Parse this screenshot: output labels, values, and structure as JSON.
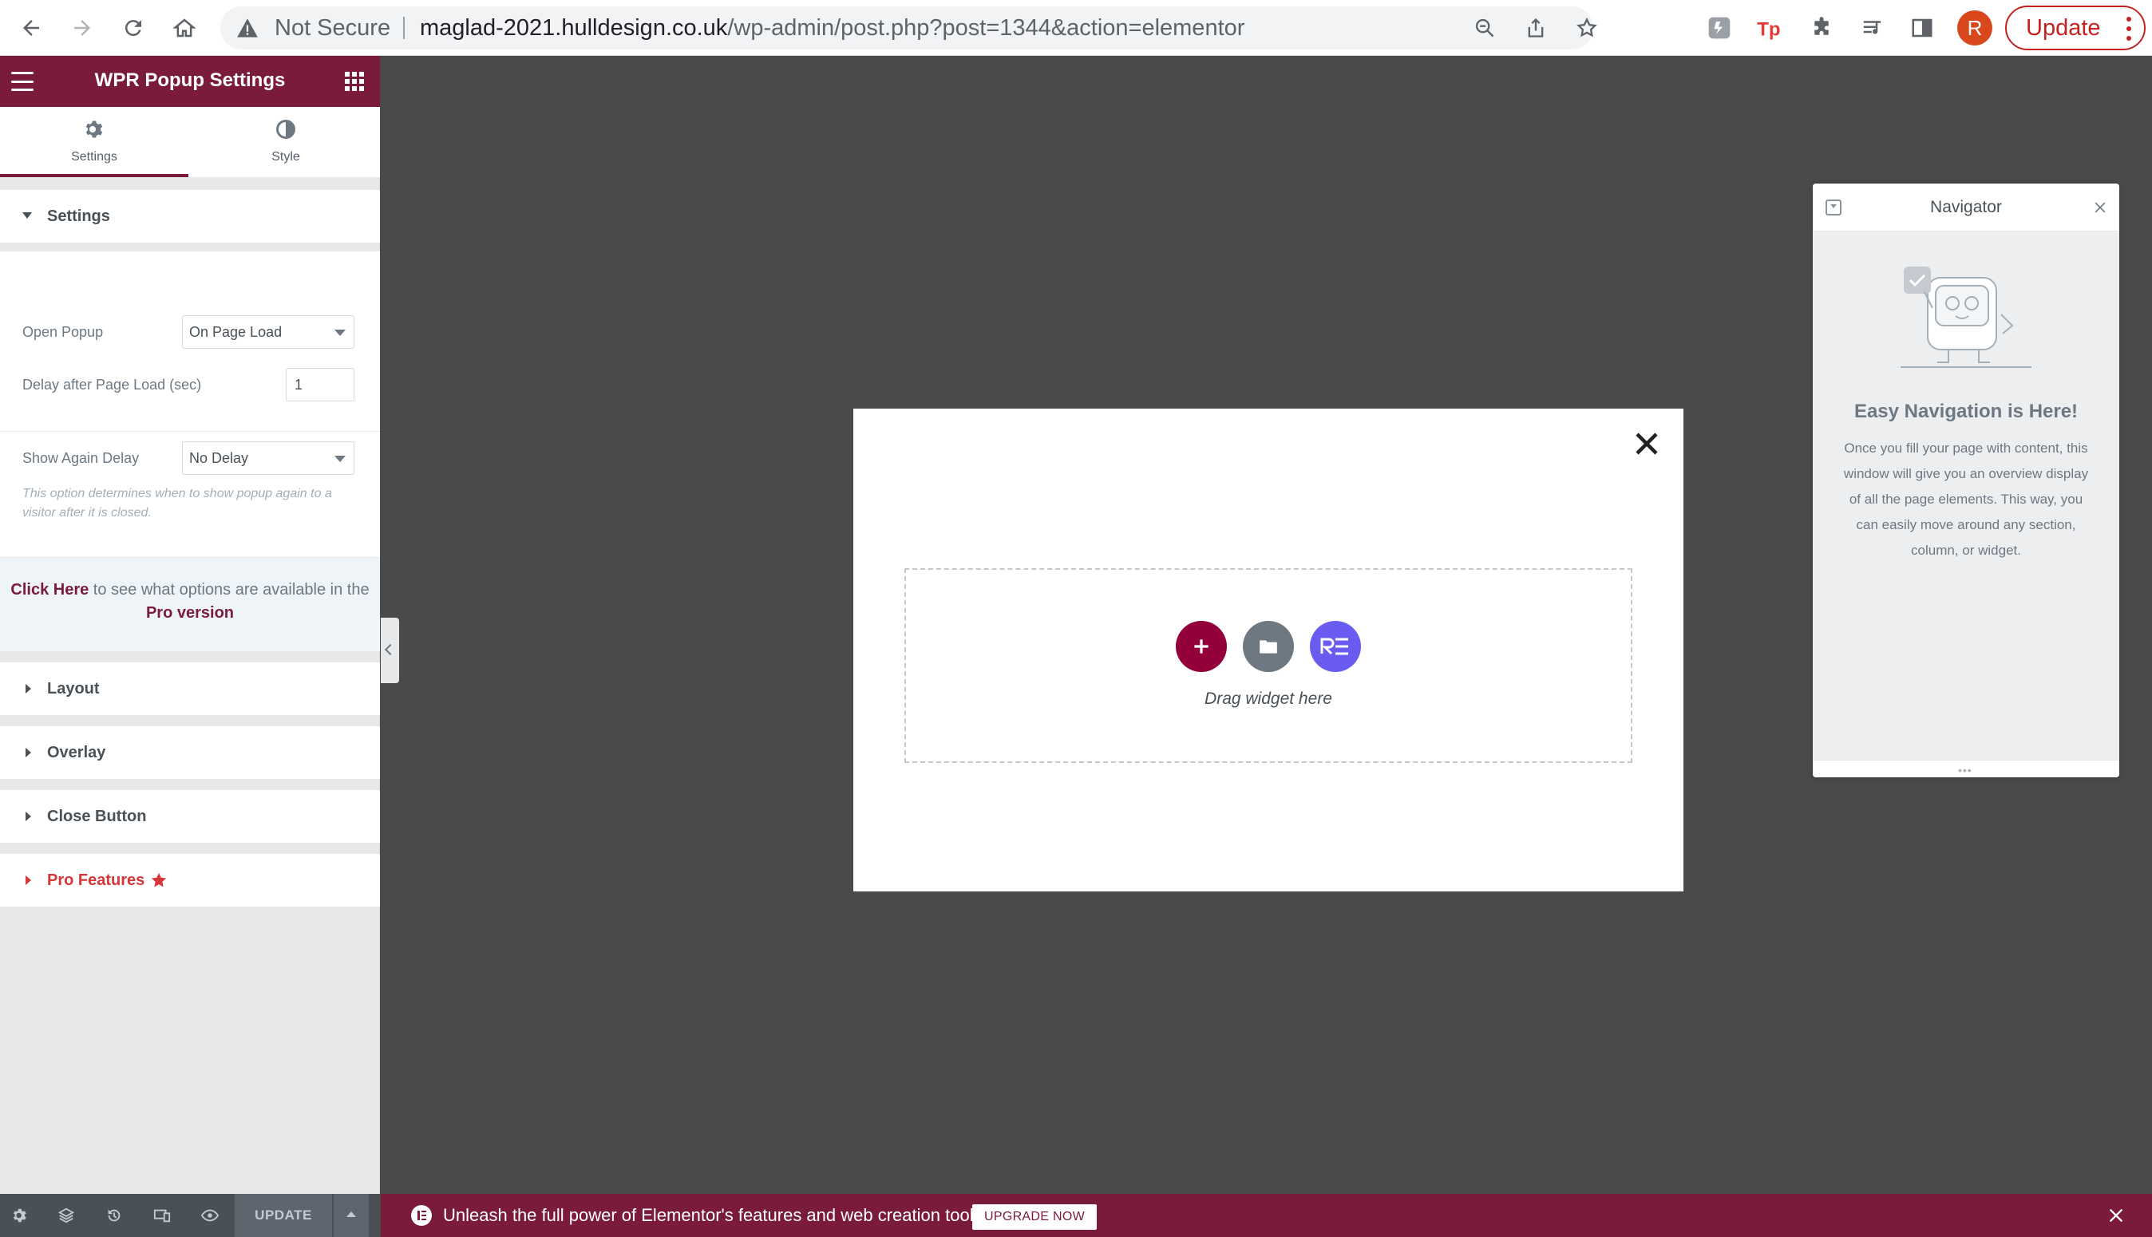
{
  "browser": {
    "security_label": "Not Secure",
    "url_host": "maglad-2021.hulldesign.co.uk",
    "url_path": "/wp-admin/post.php?post=1344&action=elementor",
    "profile_initial": "R",
    "update_label": "Update",
    "icons": [
      "back-icon",
      "forward-icon",
      "reload-icon",
      "home-icon",
      "zoom-icon",
      "share-icon",
      "bookmark-star-icon",
      "extension-icon",
      "extensions-puzzle-icon",
      "media-icon",
      "side-panel-icon",
      "menu-dots-icon"
    ]
  },
  "panel": {
    "title": "WPR Popup Settings",
    "tabs": [
      {
        "label": "Settings",
        "icon": "gear-icon",
        "active": true
      },
      {
        "label": "Style",
        "icon": "contrast-icon",
        "active": false
      }
    ],
    "settings_section": {
      "title": "Settings",
      "open_popup_label": "Open Popup",
      "open_popup_value": "On Page Load",
      "delay_label": "Delay after Page Load (sec)",
      "delay_value": "1",
      "show_again_label": "Show Again Delay",
      "show_again_value": "No Delay",
      "show_again_help": "This option determines when to show popup again to a visitor after it is closed."
    },
    "pro_notice": {
      "link_text": "Click Here",
      "middle_text": " to see what options are available in the ",
      "pro_text": "Pro version"
    },
    "sections": [
      {
        "title": "Layout"
      },
      {
        "title": "Overlay"
      },
      {
        "title": "Close Button"
      }
    ],
    "pro_features": {
      "title": "Pro Features",
      "icon": "star-icon"
    },
    "footer": {
      "update_label": "UPDATE",
      "icons": [
        "settings-icon",
        "layers-icon",
        "history-icon",
        "responsive-icon",
        "preview-eye-icon"
      ]
    }
  },
  "canvas": {
    "drag_text": "Drag widget here",
    "buttons": [
      "add-section-icon",
      "template-library-icon",
      "royal-elementor-icon"
    ]
  },
  "navigator": {
    "title": "Navigator",
    "heading": "Easy Navigation is Here!",
    "body": "Once you fill your page with content, this window will give you an overview display of all the page elements. This way, you can easily move around any section, column, or widget."
  },
  "notice": {
    "message": "Unleash the full power of Elementor's features and web creation tools.",
    "button": "UPGRADE NOW"
  },
  "colors": {
    "brand": "#7a1b3c",
    "canvas_bg": "#4a4a4a",
    "panel_bg": "#e6e8ea",
    "pro_red": "#d63638",
    "chrome_update_red": "#c5221f"
  }
}
